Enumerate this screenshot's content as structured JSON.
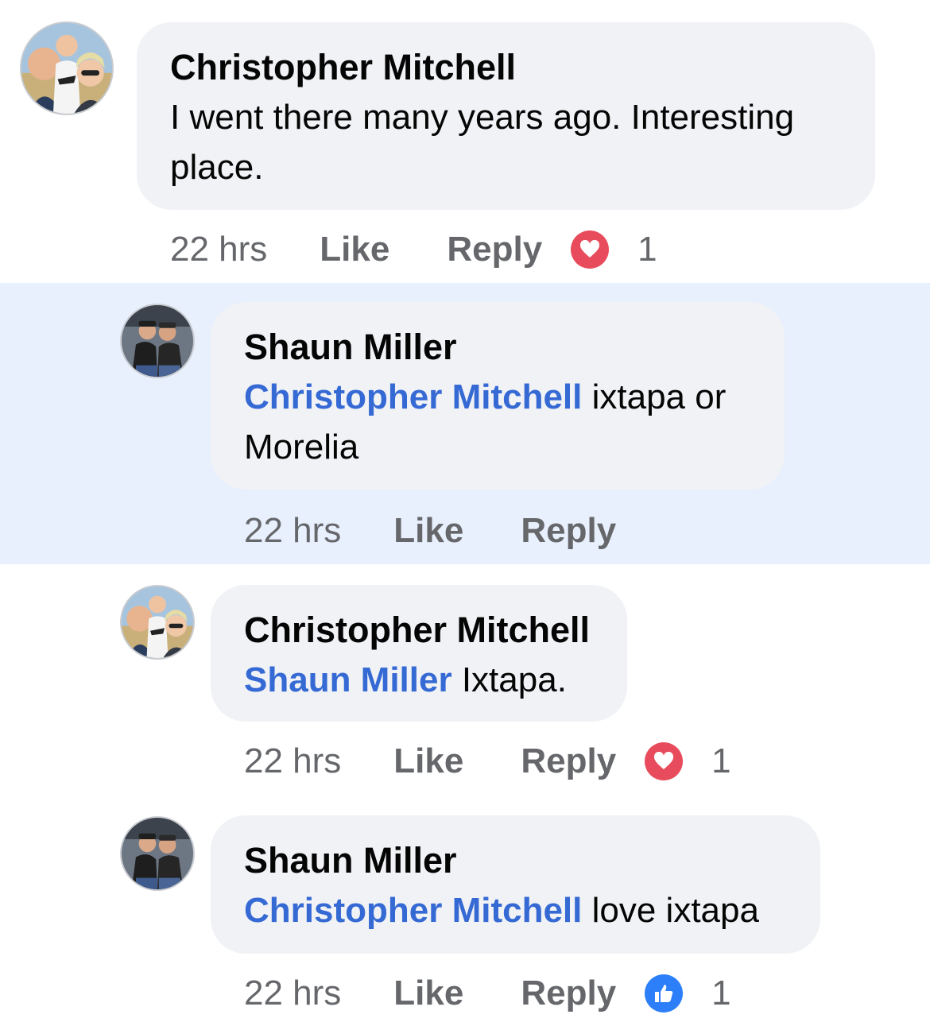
{
  "comments": [
    {
      "author": "Christopher Mitchell",
      "mention": "",
      "text": "I went there many years ago. Interesting place.",
      "time": "22 hrs",
      "like_label": "Like",
      "reply_label": "Reply",
      "reaction": "love",
      "reaction_count": "1",
      "avatar_icon": "family-photo-avatar",
      "highlighted": false
    },
    {
      "author": "Shaun Miller",
      "mention": "Christopher Mitchell",
      "text": "ixtapa or Morelia",
      "time": "22 hrs",
      "like_label": "Like",
      "reply_label": "Reply",
      "reaction": "",
      "reaction_count": "",
      "avatar_icon": "two-men-photo-avatar",
      "highlighted": true
    },
    {
      "author": "Christopher Mitchell",
      "mention": "Shaun Miller",
      "text": "Ixtapa.",
      "time": "22 hrs",
      "like_label": "Like",
      "reply_label": "Reply",
      "reaction": "love",
      "reaction_count": "1",
      "avatar_icon": "family-photo-avatar",
      "highlighted": false
    },
    {
      "author": "Shaun Miller",
      "mention": "Christopher Mitchell",
      "text": "love ixtapa",
      "time": "22 hrs",
      "like_label": "Like",
      "reply_label": "Reply",
      "reaction": "like",
      "reaction_count": "1",
      "avatar_icon": "two-men-photo-avatar",
      "highlighted": false
    }
  ],
  "colors": {
    "bubble": "#f0f2f5",
    "highlight": "#e8f0fd",
    "mention": "#3569d4",
    "meta": "#65676b",
    "love": "#e84b5c",
    "like": "#2d7ff9"
  }
}
